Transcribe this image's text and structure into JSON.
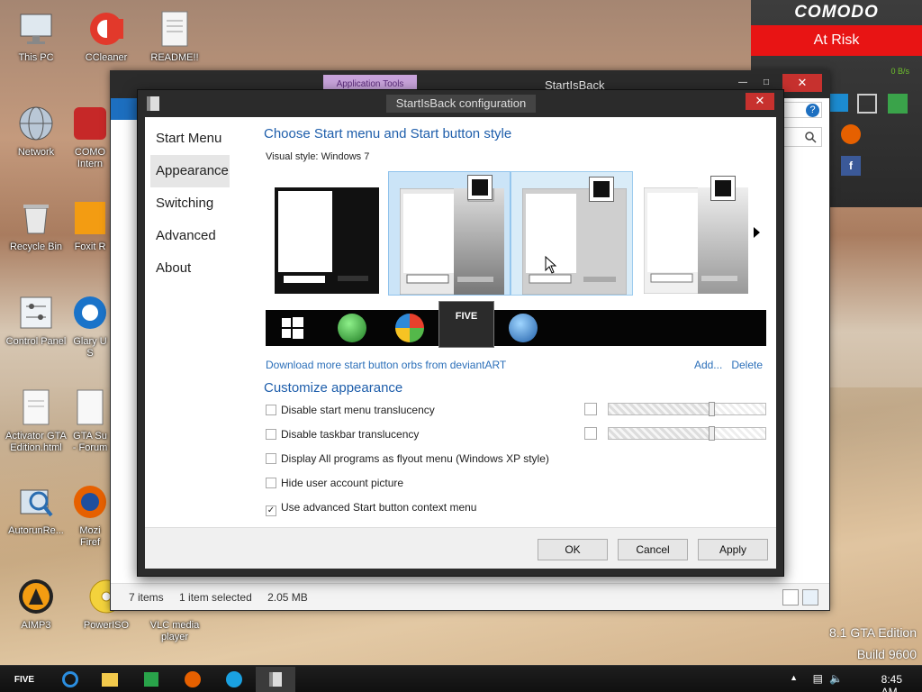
{
  "desktop": {
    "icons": [
      {
        "label": "This PC"
      },
      {
        "label": "CCleaner"
      },
      {
        "label": "README!!"
      },
      {
        "label": "Network"
      },
      {
        "label": "COMO Intern"
      },
      {
        "label": "Recycle Bin"
      },
      {
        "label": "Foxit R"
      },
      {
        "label": "Control Panel"
      },
      {
        "label": "Glary U S"
      },
      {
        "label": "Activator GTA Edition.html"
      },
      {
        "label": "GTA Su - Forum"
      },
      {
        "label": "AutorunRe..."
      },
      {
        "label": "Mozi Firef"
      },
      {
        "label": "AIMP3"
      },
      {
        "label": "PowerISO"
      },
      {
        "label": "VLC media player"
      }
    ],
    "watermark_line1": "8.1 GTA Edition",
    "watermark_line2": "Build 9600"
  },
  "comodo": {
    "title": "COMODO",
    "status": "At Risk",
    "speed": "0 B/s"
  },
  "explorer": {
    "ribbon_tab": "Application Tools",
    "title": "StartIsBack",
    "status_items": "7 items",
    "status_selected": "1 item selected",
    "status_size": "2.05 MB"
  },
  "dialog": {
    "title": "StartIsBack configuration",
    "nav": [
      {
        "label": "Start Menu"
      },
      {
        "label": "Appearance"
      },
      {
        "label": "Switching"
      },
      {
        "label": "Advanced"
      },
      {
        "label": "About"
      }
    ],
    "heading": "Choose Start menu and Start button style",
    "visual_style_label": "Visual style:",
    "visual_style_value": "Windows 7",
    "download_link": "Download more start button orbs from deviantART",
    "add_link": "Add...",
    "delete_link": "Delete",
    "customize_heading": "Customize appearance",
    "options": [
      {
        "label": "Disable start menu translucency",
        "checked": false
      },
      {
        "label": "Disable taskbar translucency",
        "checked": false
      },
      {
        "label": "Display All programs as flyout menu (Windows XP style)",
        "checked": false
      },
      {
        "label": "Hide user account picture",
        "checked": false
      },
      {
        "label": "Use advanced Start button context menu",
        "checked": true
      }
    ],
    "ok": "OK",
    "cancel": "Cancel",
    "apply": "Apply"
  },
  "taskbar": {
    "time": "8:45 AM"
  },
  "colors": {
    "accent": "#1e5eab",
    "link": "#2b6fb9",
    "close": "#c7312e",
    "comodo_risk": "#e81414"
  }
}
